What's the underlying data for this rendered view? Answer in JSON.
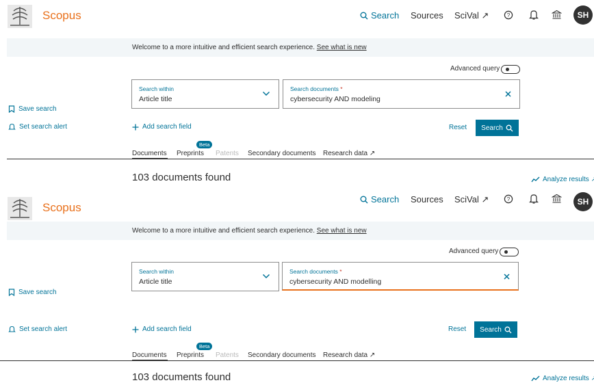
{
  "panels": [
    {
      "header": {
        "brand": "Scopus",
        "nav": {
          "search": "Search",
          "sources": "Sources",
          "scival": "SciVal ↗"
        },
        "avatar": "SH"
      },
      "banner": {
        "text": "Welcome to a more intuitive and efficient search experience.",
        "link": "See what is new"
      },
      "advanced_query": "Advanced query",
      "search_within": {
        "label": "Search within",
        "value": "Article title"
      },
      "search_documents": {
        "label": "Search documents",
        "required": "*",
        "value": "cybersecurity AND modeling"
      },
      "sidebar": {
        "save": "Save search",
        "alert": "Set search alert"
      },
      "add_field": "Add search field",
      "reset": "Reset",
      "search_button": "Search",
      "tabs": {
        "documents": "Documents",
        "preprints": "Preprints",
        "patents": "Patents",
        "secondary": "Secondary documents",
        "research": "Research data ↗",
        "beta": "Beta"
      },
      "results": "103 documents found",
      "analyze": "Analyze results ↗"
    },
    {
      "header": {
        "brand": "Scopus",
        "nav": {
          "search": "Search",
          "sources": "Sources",
          "scival": "SciVal ↗"
        },
        "avatar": "SH"
      },
      "banner": {
        "text": "Welcome to a more intuitive and efficient search experience.",
        "link": "See what is new"
      },
      "advanced_query": "Advanced query",
      "search_within": {
        "label": "Search within",
        "value": "Article title"
      },
      "search_documents": {
        "label": "Search documents",
        "required": "*",
        "value": "cybersecurity AND modelling"
      },
      "sidebar": {
        "save": "Save search",
        "alert": "Set search alert"
      },
      "add_field": "Add search field",
      "reset": "Reset",
      "search_button": "Search",
      "tabs": {
        "documents": "Documents",
        "preprints": "Preprints",
        "patents": "Patents",
        "secondary": "Secondary documents",
        "research": "Research data ↗",
        "beta": "Beta"
      },
      "results": "103 documents found",
      "analyze": "Analyze results ↗"
    }
  ],
  "colors": {
    "brand": "#e9711c",
    "accent": "#007398",
    "focus_border": "#e9711c"
  }
}
